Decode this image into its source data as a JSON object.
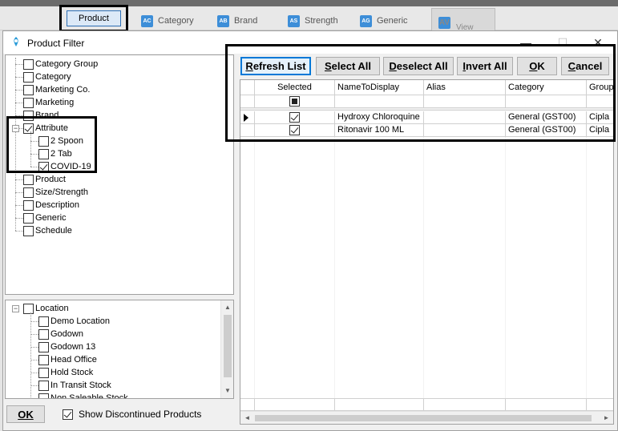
{
  "background": {
    "product_tab": "Product",
    "tabs": [
      {
        "icon": "AC",
        "label": "Category"
      },
      {
        "icon": "AB",
        "label": "Brand"
      },
      {
        "icon": "AS",
        "label": "Strength"
      },
      {
        "icon": "AG",
        "label": "Generic"
      },
      {
        "icon": "AV",
        "label": "View"
      }
    ]
  },
  "window": {
    "title": "Product Filter",
    "minimize": "—",
    "maximize": "☐",
    "close": "✕"
  },
  "filter_tree": {
    "items": [
      {
        "label": "Category Group",
        "checked": false
      },
      {
        "label": "Category",
        "checked": false
      },
      {
        "label": "Marketing Co.",
        "checked": false
      },
      {
        "label": "Marketing",
        "checked": false
      },
      {
        "label": "Brand",
        "checked": false
      },
      {
        "label": "Attribute",
        "checked": true,
        "expanded": true,
        "expander": "−",
        "children": [
          {
            "label": "2 Spoon",
            "checked": false
          },
          {
            "label": "2 Tab",
            "checked": false
          },
          {
            "label": "COVID-19",
            "checked": true
          }
        ]
      },
      {
        "label": "Product",
        "checked": false
      },
      {
        "label": "Size/Strength",
        "checked": false
      },
      {
        "label": "Description",
        "checked": false
      },
      {
        "label": "Generic",
        "checked": false
      },
      {
        "label": "Schedule",
        "checked": false
      }
    ]
  },
  "location_tree": {
    "root": {
      "label": "Location",
      "checked": false,
      "expander": "−"
    },
    "children": [
      {
        "label": "Demo Location",
        "checked": false
      },
      {
        "label": "Godown",
        "checked": false
      },
      {
        "label": "Godown 13",
        "checked": false
      },
      {
        "label": "Head Office",
        "checked": false
      },
      {
        "label": "Hold Stock",
        "checked": false
      },
      {
        "label": "In Transit Stock",
        "checked": false
      },
      {
        "label": "Non Saleable Stock",
        "checked": false
      }
    ],
    "scroll_up": "▲",
    "scroll_down": "▼"
  },
  "bottom": {
    "ok_label": "OK",
    "show_discontinued_label": "Show Discontinued Products",
    "show_discontinued_checked": true
  },
  "toolbar": {
    "refresh_list": "Refresh List",
    "select_all": "Select All",
    "deselect_all": "Deselect All",
    "invert_all": "Invert All",
    "ok": "OK",
    "cancel": "Cancel"
  },
  "grid": {
    "columns": [
      "Selected",
      "NameToDisplay",
      "Alias",
      "Category",
      "Group"
    ],
    "filter_row_selected": "indeterminate",
    "rows": [
      {
        "current": true,
        "selected": true,
        "name": "Hydroxy Chloroquine",
        "alias": "",
        "category": "General (GST00)",
        "group": "Cipla"
      },
      {
        "current": false,
        "selected": true,
        "name": "Ritonavir 100 ML",
        "alias": "",
        "category": "General (GST00)",
        "group": "Cipla"
      }
    ],
    "scroll_left": "◄",
    "scroll_right": "►"
  }
}
